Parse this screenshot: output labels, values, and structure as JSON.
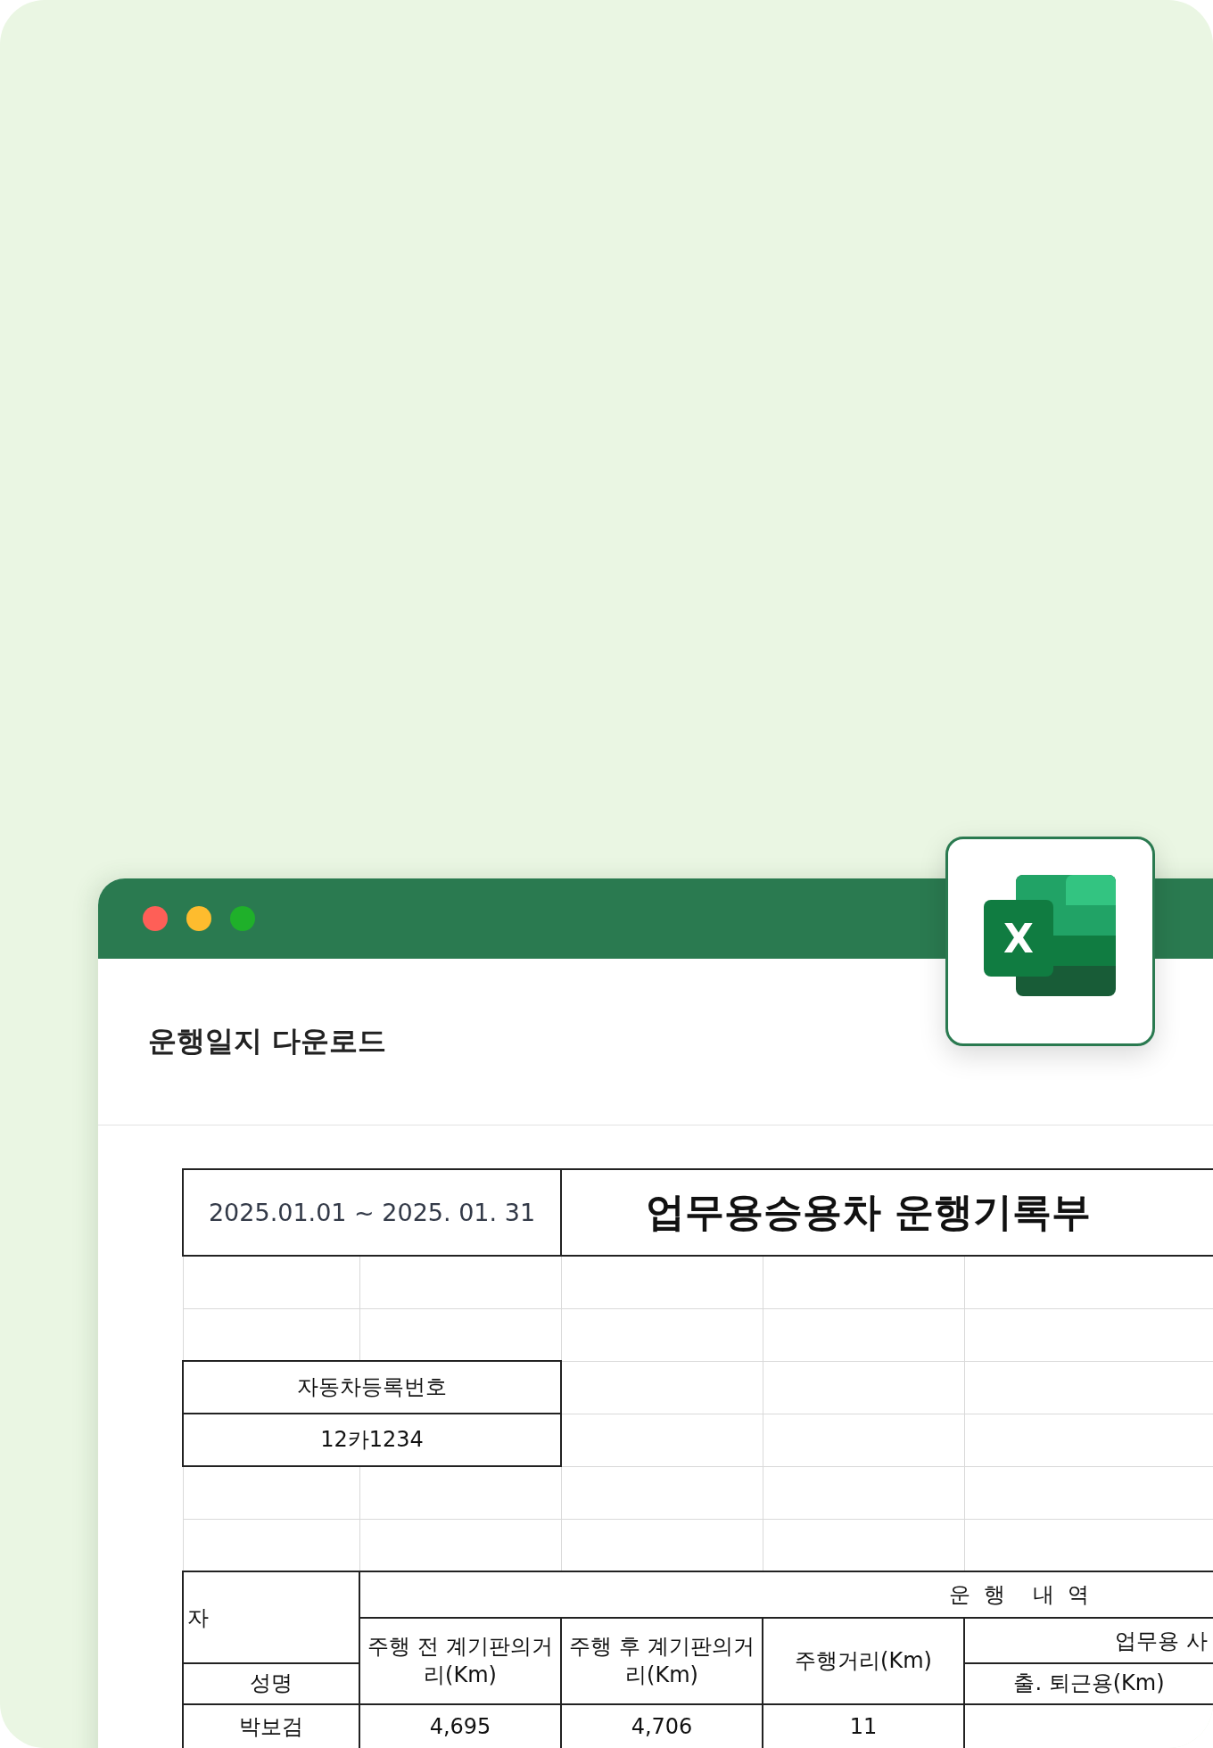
{
  "window": {
    "title": "운행일지 다운로드"
  },
  "app_icon": {
    "letter": "X"
  },
  "sheet": {
    "period": "2025.01.01 ~ 2025. 01. 31",
    "title": "업무용승용차 운행기록부",
    "vehicle_label": "자동차등록번호",
    "vehicle_number": "12카1234",
    "header": {
      "user_label": "자",
      "section_label": "운  행    내  역",
      "columns": [
        "주행 전 계기판의거리(Km)",
        "주행 후 계기판의거리(Km)",
        "주행거리(Km)"
      ],
      "business_label": "업무용 사",
      "commute_label": "출. 퇴근용(Km)",
      "name_label": "성명"
    },
    "rows": [
      {
        "name": "박보검",
        "before": "4,695",
        "after": "4,706",
        "distance": "11"
      }
    ]
  }
}
